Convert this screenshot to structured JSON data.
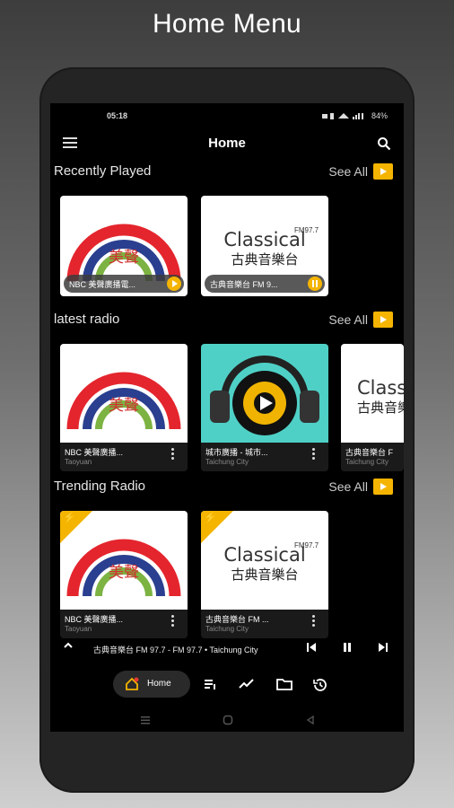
{
  "promo_title": "Home Menu",
  "status_bar": {
    "time": "05:18",
    "battery": "84%"
  },
  "app_bar": {
    "title": "Home"
  },
  "accent_color": "#f4b400",
  "sections": {
    "recently_played": {
      "title": "Recently Played",
      "see_all": "See All",
      "items": [
        {
          "title": "NBC 美聲廣播電...",
          "logo": "nbc-logo"
        },
        {
          "title": "古典音樂台 FM 9...",
          "logo": "classical-logo"
        }
      ]
    },
    "latest_radio": {
      "title": "latest radio",
      "see_all": "See All",
      "items": [
        {
          "name": "NBC 美聲廣播...",
          "city": "Taoyuan",
          "logo": "nbc-logo"
        },
        {
          "name": "城市廣播 - 城市...",
          "city": "Taichung City",
          "logo": "speaker-logo"
        },
        {
          "name": "古典音樂台 F",
          "city": "Taichung City",
          "logo": "classical-logo"
        }
      ]
    },
    "trending_radio": {
      "title": "Trending Radio",
      "see_all": "See All",
      "items": [
        {
          "name": "NBC 美聲廣播...",
          "city": "Taoyuan",
          "logo": "nbc-logo"
        },
        {
          "name": "古典音樂台 FM ...",
          "city": "Taichung City",
          "logo": "classical-logo"
        }
      ]
    }
  },
  "logos": {
    "nbc": {
      "chars": "美聲"
    },
    "classical": {
      "word": "Classical",
      "freq": "FM97.7",
      "chars": "古典音樂台"
    }
  },
  "mini_player": {
    "track": "古典音樂台 FM 97.7 - FM 97.7 • Taichung City"
  },
  "bottom_nav": {
    "home_label": "Home"
  }
}
